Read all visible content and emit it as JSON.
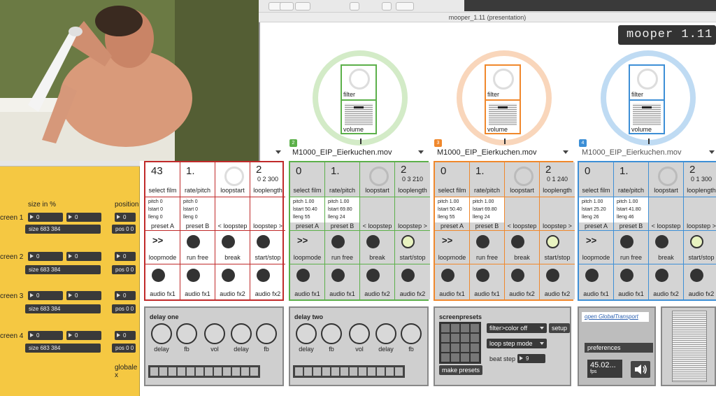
{
  "window_title": "mooper_1.11 (presentation)",
  "logo": "mooper 1.11",
  "left_panel": {
    "col_size": "size in %",
    "col_position": "position",
    "screens": [
      {
        "label": "creen 1",
        "n1": "0",
        "n2": "0",
        "size": "size 683 384",
        "pos": "pos 0 0",
        "pos_n": "0"
      },
      {
        "label": "creen 2",
        "n1": "0",
        "n2": "0",
        "size": "size 683 384",
        "pos": "pos 0 0",
        "pos_n": "0"
      },
      {
        "label": "creen 3",
        "n1": "0",
        "n2": "0",
        "size": "size 683 384",
        "pos": "pos 0 0",
        "pos_n": "0"
      },
      {
        "label": "creen 4",
        "n1": "0",
        "n2": "0",
        "size": "size 683 384",
        "pos": "pos 0 0",
        "pos_n": "0"
      }
    ],
    "globale": "globale",
    "globale_x": "x"
  },
  "mixers": [
    {
      "filter": "filter",
      "volume": "volume",
      "color": "#d3ebc7",
      "accent": "#5cb04a"
    },
    {
      "filter": "filter",
      "volume": "volume",
      "color": "#f9d6bb",
      "accent": "#f0882c"
    },
    {
      "filter": "filter",
      "volume": "volume",
      "color": "#bfdbf3",
      "accent": "#3d8fd6"
    }
  ],
  "players": [
    {
      "number": "",
      "movie": "",
      "color": "#c02a2a",
      "select_film_val": "43",
      "select_film": "select film",
      "rate_val": "1.",
      "rate": "rate/pitch",
      "loopstart": "loopstart",
      "looplength_val": "2",
      "looplength_sub": "0 2 300",
      "looplength": "looplength",
      "preset_a_lines": [
        "pitch 0",
        "lstart 0",
        "lleng 0"
      ],
      "preset_a": "preset A",
      "preset_b_lines": [
        "pitch 0",
        "lstart 0",
        "lleng 0"
      ],
      "preset_b": "preset B",
      "loopstep_back": "< loopstep",
      "loopstep_fwd": "loopstep >",
      "loopmode_sym": ">>",
      "loopmode": "loopmode",
      "run_free": "run free",
      "break": "break",
      "start_stop": "start/stop",
      "fx": [
        "audio fx1",
        "audio fx1",
        "audio fx2",
        "audio fx2"
      ]
    },
    {
      "number": "2",
      "movie": "M1000_EIP_Eierkuchen.mov",
      "color": "#5cb04a",
      "select_film_val": "0",
      "select_film": "select film",
      "rate_val": "1.",
      "rate": "rate/pitch",
      "loopstart": "loopstart",
      "looplength_val": "2",
      "looplength_sub": "0 3 210",
      "looplength": "looplength",
      "preset_a_lines": [
        "pitch 1.00",
        "lstart 50.40",
        "lleng 55"
      ],
      "preset_a": "preset A",
      "preset_b_lines": [
        "pitch 1.00",
        "lstart 69.80",
        "lleng 24"
      ],
      "preset_b": "preset B",
      "loopstep_back": "< loopstep",
      "loopstep_fwd": "loopstep >",
      "loopmode_sym": ">>",
      "loopmode": "loopmode",
      "run_free": "run free",
      "break": "break",
      "start_stop": "start/stop",
      "fx": [
        "audio fx1",
        "audio fx1",
        "audio fx2",
        "audio fx2"
      ]
    },
    {
      "number": "3",
      "movie": "M1000_EIP_Eierkuchen.mov",
      "color": "#f0882c",
      "select_film_val": "0",
      "select_film": "select film",
      "rate_val": "1.",
      "rate": "rate/pitch",
      "loopstart": "loopstart",
      "looplength_val": "2",
      "looplength_sub": "0 1 240",
      "looplength": "looplength",
      "preset_a_lines": [
        "pitch 1.00",
        "lstart 50.40",
        "lleng 55"
      ],
      "preset_a": "preset A",
      "preset_b_lines": [
        "pitch 1.00",
        "lstart 69.80",
        "lleng 24"
      ],
      "preset_b": "preset B",
      "loopstep_back": "< loopstep",
      "loopstep_fwd": "loopstep >",
      "loopmode_sym": ">>",
      "loopmode": "loopmode",
      "run_free": "run free",
      "break": "break",
      "start_stop": "start/stop",
      "fx": [
        "audio fx1",
        "audio fx1",
        "audio fx2",
        "audio fx2"
      ]
    },
    {
      "number": "4",
      "movie": "M1000_EIP_Eierkuchen.mov",
      "color": "#3d8fd6",
      "select_film_val": "0",
      "select_film": "select film",
      "rate_val": "1.",
      "rate": "rate/pitch",
      "loopstart": "loopstart",
      "looplength_val": "2",
      "looplength_sub": "0 1 300",
      "looplength": "looplength",
      "preset_a_lines": [
        "pitch 1.00",
        "lstart 25.20",
        "lleng 26"
      ],
      "preset_a": "preset A",
      "preset_b_lines": [
        "pitch 1.00",
        "lstart 41.80",
        "lleng 46"
      ],
      "preset_b": "preset B",
      "loopstep_back": "< loopstep",
      "loopstep_fwd": "loopstep >",
      "loopmode_sym": ">>",
      "loopmode": "loopmode",
      "run_free": "run free",
      "break": "break",
      "start_stop": "start/stop",
      "fx": [
        "audio fx1",
        "audio fx1",
        "audio fx2",
        "audio fx2"
      ]
    }
  ],
  "delay_one": {
    "title": "delay one",
    "knobs": [
      "delay",
      "fb",
      "vol",
      "delay",
      "fb"
    ]
  },
  "delay_two": {
    "title": "delay two",
    "knobs": [
      "delay",
      "fb",
      "vol",
      "delay",
      "fb"
    ]
  },
  "screenpresets": {
    "title": "screenpresets",
    "filter": "filter>color off",
    "setup": "setup",
    "loop_step": "loop step mode",
    "beat_step_label": "beat step",
    "beat_step_val": "9",
    "make": "make presets"
  },
  "transport": {
    "open": "open GlobalTransport",
    "prefs": "preferences",
    "fps_val": "45.02...",
    "fps": "fps"
  }
}
